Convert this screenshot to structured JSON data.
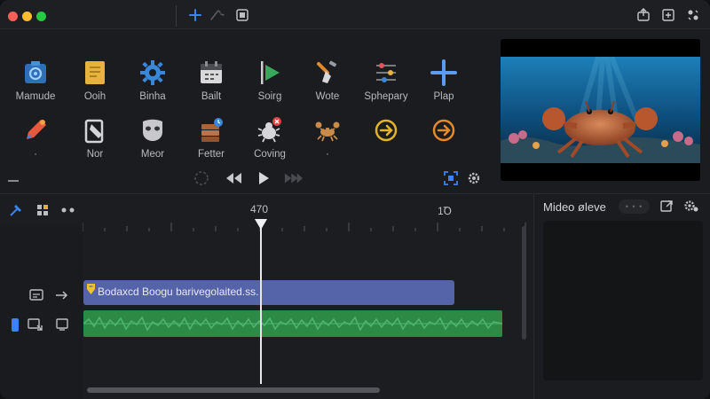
{
  "tools_row1": [
    {
      "label": "Mamude",
      "icon": "camera-gear-icon"
    },
    {
      "label": "Ooih",
      "icon": "document-icon"
    },
    {
      "label": "Binha",
      "icon": "gear-icon"
    },
    {
      "label": "Bailt",
      "icon": "calendar-icon"
    },
    {
      "label": "Soirg",
      "icon": "play-flag-icon"
    },
    {
      "label": "Wote",
      "icon": "brush-icon"
    },
    {
      "label": "Sphepary",
      "icon": "sliders-icon"
    },
    {
      "label": "Plap",
      "icon": "plus-icon"
    }
  ],
  "tools_row2": [
    {
      "label": "·",
      "icon": "pen-icon"
    },
    {
      "label": "Nor",
      "icon": "clipboard-icon"
    },
    {
      "label": "Meor",
      "icon": "mask-icon"
    },
    {
      "label": "Fetter",
      "icon": "stack-icon"
    },
    {
      "label": "Coving",
      "icon": "bug-icon"
    },
    {
      "label": "·",
      "icon": "crab-icon"
    },
    {
      "label": "",
      "icon": "forward-circle-icon"
    },
    {
      "label": "",
      "icon": "forward-circle-icon"
    }
  ],
  "timeline": {
    "ruler_marks": [
      "470",
      "1Ꝺ"
    ],
    "blue_clip_text": "Bodaxcd Boogu barivegolaited.ss.",
    "playhead_fraction": 0.4
  },
  "side_panel": {
    "title": "Mideo øleve",
    "pill": "• • •"
  },
  "colors": {
    "accent": "#3b82f6",
    "clip_blue": "#5563a8",
    "clip_green": "#2c8a45",
    "ring_gold": "#e3b32a",
    "ring_orange": "#e58a2a"
  }
}
